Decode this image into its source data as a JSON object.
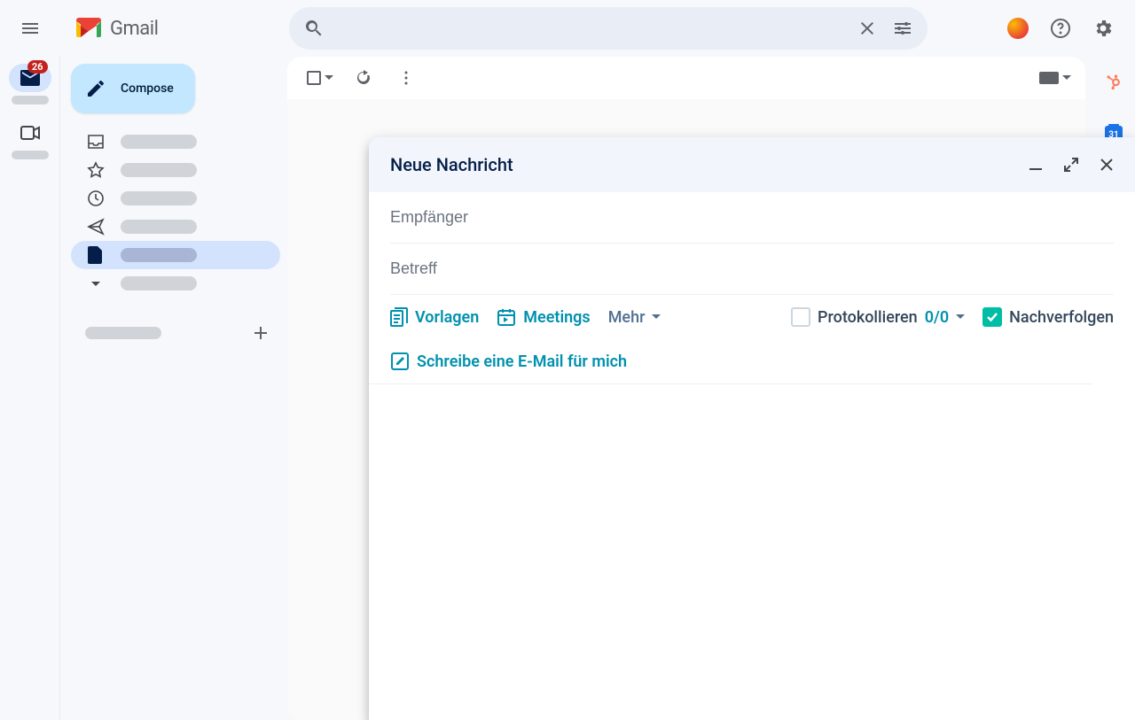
{
  "header": {
    "app_name": "Gmail",
    "search_placeholder": "",
    "badge": "26"
  },
  "sidebar": {
    "compose_label": "Compose"
  },
  "toolbar": {
    "calendar_day": "31"
  },
  "compose": {
    "title": "Neue Nachricht",
    "recipients_placeholder": "Empfänger",
    "subject_placeholder": "Betreff",
    "hubspot": {
      "templates": "Vorlagen",
      "meetings": "Meetings",
      "more": "Mehr",
      "log": "Protokollieren",
      "log_count": "0/0",
      "track": "Nachverfolgen",
      "write_for_me": "Schreibe eine E-Mail für mich"
    }
  }
}
